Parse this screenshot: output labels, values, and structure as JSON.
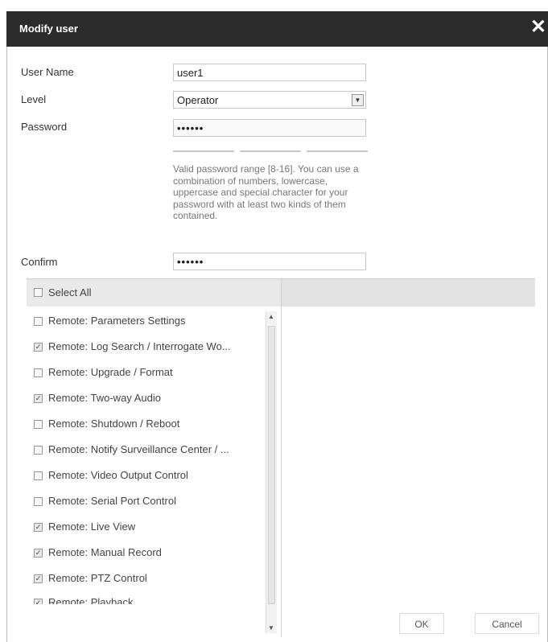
{
  "dialog": {
    "title": "Modify user",
    "close_glyph": "✕",
    "close_icon": "close-icon"
  },
  "form": {
    "username_label": "User Name",
    "username_value": "user1",
    "level_label": "Level",
    "level_value": "Operator",
    "password_label": "Password",
    "password_value": "••••••",
    "hint": "Valid password range [8-16]. You can use a combination of numbers, lowercase, uppercase and special character for your password with at least two kinds of them contained.",
    "confirm_label": "Confirm",
    "confirm_value": "••••••"
  },
  "permissions": {
    "select_all": "Select All",
    "items": [
      {
        "label": "Remote: Parameters Settings",
        "checked": false
      },
      {
        "label": "Remote: Log Search / Interrogate Wo...",
        "checked": true
      },
      {
        "label": "Remote: Upgrade / Format",
        "checked": false
      },
      {
        "label": "Remote: Two-way Audio",
        "checked": true
      },
      {
        "label": "Remote: Shutdown / Reboot",
        "checked": false
      },
      {
        "label": "Remote: Notify Surveillance Center / ...",
        "checked": false
      },
      {
        "label": "Remote: Video Output Control",
        "checked": false
      },
      {
        "label": "Remote: Serial Port Control",
        "checked": false
      },
      {
        "label": "Remote: Live View",
        "checked": true
      },
      {
        "label": "Remote: Manual Record",
        "checked": true
      },
      {
        "label": "Remote: PTZ Control",
        "checked": true
      },
      {
        "label": "Remote: Playback",
        "checked": true
      }
    ]
  },
  "buttons": {
    "ok": "OK",
    "cancel": "Cancel"
  }
}
